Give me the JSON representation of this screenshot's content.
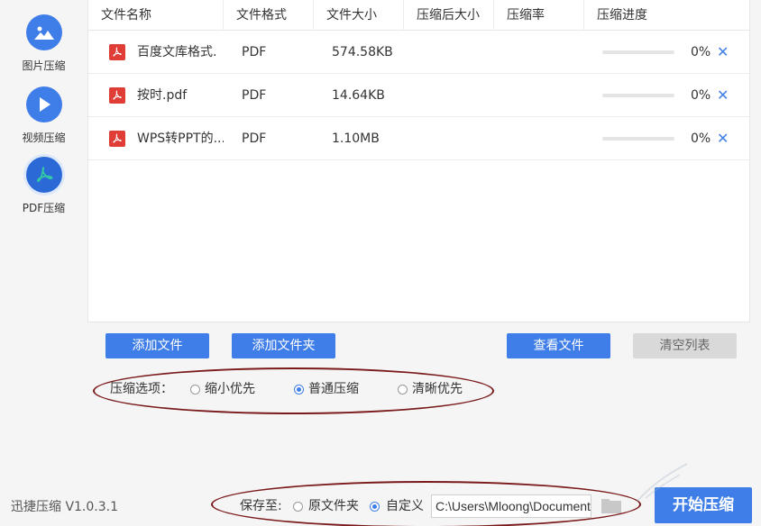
{
  "sidebar": {
    "items": [
      {
        "label": "图片压缩",
        "icon": "image-icon"
      },
      {
        "label": "视频压缩",
        "icon": "play-icon"
      },
      {
        "label": "PDF压缩",
        "icon": "pdf-icon"
      }
    ]
  },
  "table": {
    "headers": [
      "文件名称",
      "文件格式",
      "文件大小",
      "压缩后大小",
      "压缩率",
      "压缩进度"
    ],
    "rows": [
      {
        "name": "百度文库格式.",
        "format": "PDF",
        "size": "574.58KB",
        "compressed": "",
        "ratio": "",
        "progress": "0%",
        "progress_value": 0
      },
      {
        "name": "按时.pdf",
        "format": "PDF",
        "size": "14.64KB",
        "compressed": "",
        "ratio": "",
        "progress": "0%",
        "progress_value": 0
      },
      {
        "name": "WPS转PPT的...",
        "format": "PDF",
        "size": "1.10MB",
        "compressed": "",
        "ratio": "",
        "progress": "0%",
        "progress_value": 0
      }
    ]
  },
  "buttons": {
    "add_file": "添加文件",
    "add_folder": "添加文件夹",
    "view_files": "查看文件",
    "clear_list": "清空列表"
  },
  "options": {
    "label": "压缩选项：",
    "choices": [
      "缩小优先",
      "普通压缩",
      "清晰优先"
    ],
    "selected": "普通压缩"
  },
  "footer": {
    "version": "迅捷压缩 V1.0.3.1",
    "save_label": "保存至:",
    "save_choices": [
      "原文件夹",
      "自定义"
    ],
    "save_selected": "自定义",
    "path": "C:\\Users\\Mloong\\Documents",
    "start_button": "开始压缩"
  },
  "colors": {
    "accent": "#3f7ee8",
    "pdf_red": "#e03d36",
    "annotation": "#7a1a1a"
  }
}
